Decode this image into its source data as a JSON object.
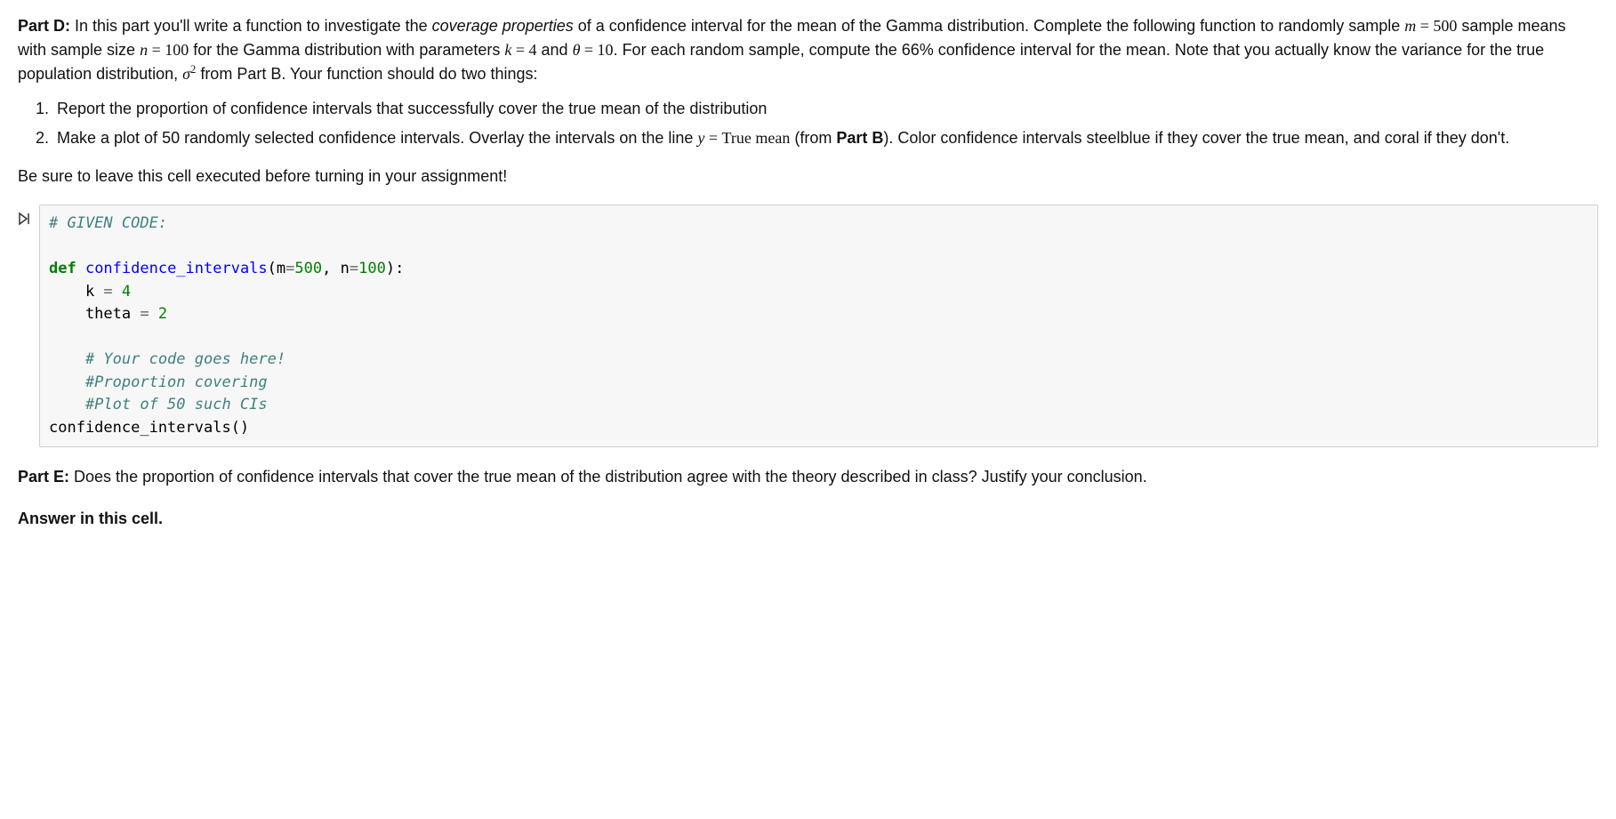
{
  "partD": {
    "label": "Part D:",
    "intro_1": " In this part you'll write a function to investigate the ",
    "intro_italic": "coverage properties",
    "intro_2": " of a confidence interval for the mean of the Gamma distribution. Complete the following function to randomly sample ",
    "m_eq": "m = 500",
    "intro_3": " sample means with sample size ",
    "n_eq": "n = 100",
    "intro_4": " for the Gamma distribution with parameters ",
    "k_eq": "k = 4",
    "intro_5": " and ",
    "theta_eq": "θ = 10",
    "intro_6": ". For each random sample, compute the 66% confidence interval for the mean. Note that you actually know the variance for the true population distribution, ",
    "sigma": "σ",
    "sigma_exp": "2",
    "intro_7": " from Part B. Your function should do two things:",
    "item1": "Report the proportion of confidence intervals that successfully cover the true mean of the distribution",
    "item2_a": "Make a plot of 50 randomly selected confidence intervals. Overlay the intervals on the line ",
    "item2_y": "y = ",
    "item2_truemean": "True mean",
    "item2_b": " (from ",
    "item2_partb": "Part B",
    "item2_c": "). Color confidence intervals steelblue if they cover the true mean, and coral if they don't.",
    "closing": "Be sure to leave this cell executed before turning in your assignment!"
  },
  "code": {
    "l1": "# GIVEN CODE:",
    "l2": "",
    "def_kw": "def",
    "func_name": " confidence_intervals",
    "open_paren": "(",
    "p1": "m",
    "eq1": "=",
    "v1": "500",
    "comma": ", ",
    "p2": "n",
    "eq2": "=",
    "v2": "100",
    "close_paren": "):",
    "l4a": "    k ",
    "l4b": "=",
    "l4c": " 4",
    "l5a": "    theta ",
    "l5b": "=",
    "l5c": " 2",
    "l6": "",
    "l7": "    # Your code goes here!",
    "l8": "    #Proportion covering",
    "l9": "    #Plot of 50 such CIs",
    "l10": "confidence_intervals()"
  },
  "partE": {
    "label": "Part E:",
    "text": " Does the proportion of confidence intervals that cover the true mean of the distribution agree with the theory described in class? Justify your conclusion."
  },
  "answer": {
    "text": "Answer in this cell."
  },
  "icons": {
    "run": "▶|"
  }
}
